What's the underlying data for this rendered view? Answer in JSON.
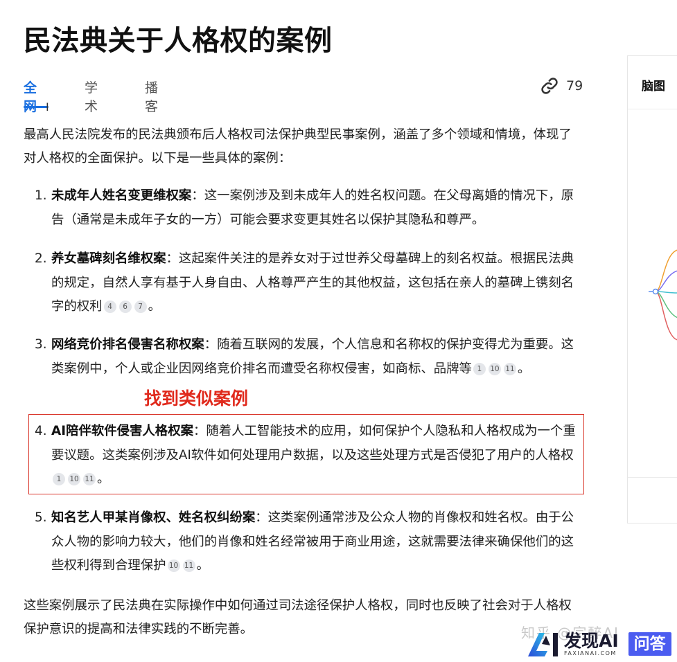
{
  "page": {
    "title": "民法典关于人格权的案例"
  },
  "tabs": [
    {
      "label": "全网",
      "active": true
    },
    {
      "label": "学术",
      "active": false
    },
    {
      "label": "播客",
      "active": false
    }
  ],
  "sources": {
    "icon": "link-icon",
    "count": "79"
  },
  "intro": "最高人民法院发布的民法典颁布后人格权司法保护典型民事案例，涵盖了多个领域和情境，体现了对人格权的全面保护。以下是一些具体的案例：",
  "cases": [
    {
      "num": "1.",
      "title": "未成年人姓名变更维权案",
      "text": "：这一案例涉及到未成年人的姓名权问题。在父母离婚的情况下，原告（通常是未成年子女的一方）可能会要求变更其姓名以保护其隐私和尊严。",
      "cites": []
    },
    {
      "num": "2.",
      "title": "养女墓碑刻名维权案",
      "text": "：这起案件关注的是养女对于过世养父母墓碑上的刻名权益。根据民法典的规定，自然人享有基于人身自由、人格尊严产生的其他权益，这包括在亲人的墓碑上镌刻名字的权利",
      "cites": [
        "4",
        "6",
        "7"
      ]
    },
    {
      "num": "3.",
      "title": "网络竞价排名侵害名称权案",
      "text": "：随着互联网的发展，个人信息和名称权的保护变得尤为重要。这类案例中，个人或企业因网络竞价排名而遭受名称权侵害，如商标、品牌等",
      "cites": [
        "1",
        "10",
        "11"
      ]
    },
    {
      "num": "4.",
      "title": "AI陪伴软件侵害人格权案",
      "text": "：随着人工智能技术的应用，如何保护个人隐私和人格权成为一个重要议题。这类案例涉及AI软件如何处理用户数据，以及这些处理方式是否侵犯了用户的人格权",
      "cites": [
        "1",
        "10",
        "11"
      ]
    },
    {
      "num": "5.",
      "title": "知名艺人甲某肖像权、姓名权纠纷案",
      "text": "：这类案例通常涉及公众人物的肖像权和姓名权。由于公众人物的影响力较大，他们的肖像和姓名经常被用于商业用途，这就需要法律来确保他们的这些权利得到合理保护",
      "cites": [
        "10",
        "11"
      ]
    }
  ],
  "end_mark": "。",
  "annotation": "找到类似案例",
  "outro": "这些案例展示了民法典在实际操作中如何通过司法途径保护人格权，同时也反映了社会对于人格权保护意识的提高和法律实践的不断完善。",
  "side_panel": {
    "title": "脑图"
  },
  "watermark": "知乎 @宗醉AI",
  "brand": {
    "main": "发现AI",
    "sub": "FAXIANAI.COM",
    "badge": "问答"
  },
  "colors": {
    "accent": "#1a6fe0",
    "annotation": "#e0291c",
    "brand_badge": "#4b5cf0"
  }
}
